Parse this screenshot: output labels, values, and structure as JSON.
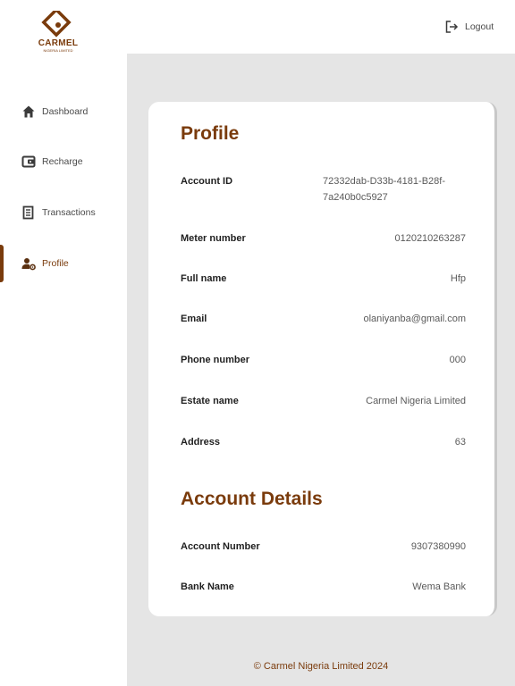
{
  "brand": {
    "name": "CARMEL",
    "tagline": "NIGERIA LIMITED",
    "color": "#7a3b0c"
  },
  "sidebar": {
    "items": [
      {
        "label": "Dashboard",
        "icon": "home-icon",
        "active": false
      },
      {
        "label": "Recharge",
        "icon": "wallet-icon",
        "active": false
      },
      {
        "label": "Transactions",
        "icon": "receipt-icon",
        "active": false
      },
      {
        "label": "Profile",
        "icon": "user-settings-icon",
        "active": true
      }
    ]
  },
  "header": {
    "logout_label": "Logout"
  },
  "profile": {
    "title": "Profile",
    "fields": [
      {
        "label": "Account ID",
        "value": "72332dab-D33b-4181-B28f-7a240b0c5927"
      },
      {
        "label": "Meter number",
        "value": "0120210263287"
      },
      {
        "label": "Full name",
        "value": "Hfp"
      },
      {
        "label": "Email",
        "value": "olaniyanba@gmail.com"
      },
      {
        "label": "Phone number",
        "value": "000"
      },
      {
        "label": "Estate name",
        "value": "Carmel Nigeria Limited"
      },
      {
        "label": "Address",
        "value": "63"
      }
    ]
  },
  "account_details": {
    "title": "Account Details",
    "fields": [
      {
        "label": "Account Number",
        "value": "9307380990"
      },
      {
        "label": "Bank Name",
        "value": "Wema Bank"
      }
    ]
  },
  "footer": {
    "text": "© Carmel Nigeria Limited 2024"
  }
}
